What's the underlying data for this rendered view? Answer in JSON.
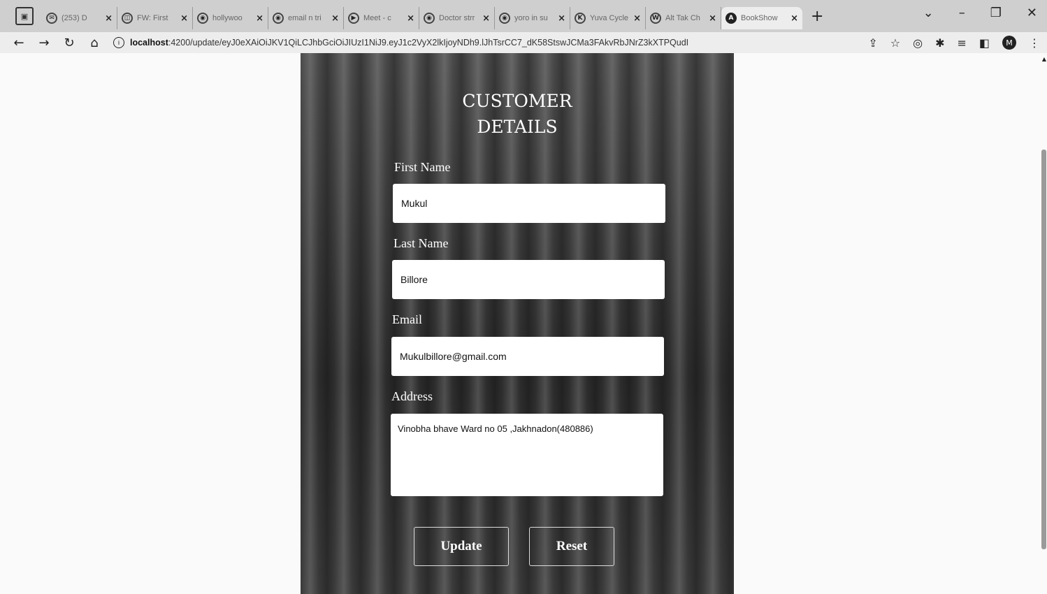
{
  "browser": {
    "tabs": [
      {
        "title": "(253) D",
        "icon": "mail-icon"
      },
      {
        "title": "FW: First",
        "icon": "outlook-icon"
      },
      {
        "title": "hollywoo",
        "icon": "chrome-icon"
      },
      {
        "title": "email n tri",
        "icon": "chrome-icon"
      },
      {
        "title": "Meet - c",
        "icon": "meet-icon"
      },
      {
        "title": "Doctor strr",
        "icon": "chrome-icon"
      },
      {
        "title": "yoro in su",
        "icon": "chrome-icon"
      },
      {
        "title": "Yuva Cycle",
        "icon": "k-icon"
      },
      {
        "title": "Alt Tak Ch",
        "icon": "w-icon"
      },
      {
        "title": "BookShow",
        "icon": "angular-icon",
        "active": true
      }
    ],
    "url_host": "localhost",
    "url_path": ":4200/update/eyJ0eXAiOiJKV1QiLCJhbGciOiJIUzI1NiJ9.eyJ1c2VyX2lkIjoyNDh9.lJhTsrCC7_dK58StswJCMa3FAkvRbJNrZ3kXTPQudI"
  },
  "form": {
    "title_line1": "CUSTOMER",
    "title_line2": "DETAILS",
    "first_name_label": "First Name",
    "first_name_value": "Mukul",
    "last_name_label": "Last Name",
    "last_name_value": "Billore",
    "email_label": "Email",
    "email_value": "Mukulbillore@gmail.com",
    "address_label": "Address",
    "address_value": "Vinobha bhave Ward no 05 ,Jakhnadon(480886)",
    "update_button": "Update",
    "reset_button": "Reset"
  }
}
